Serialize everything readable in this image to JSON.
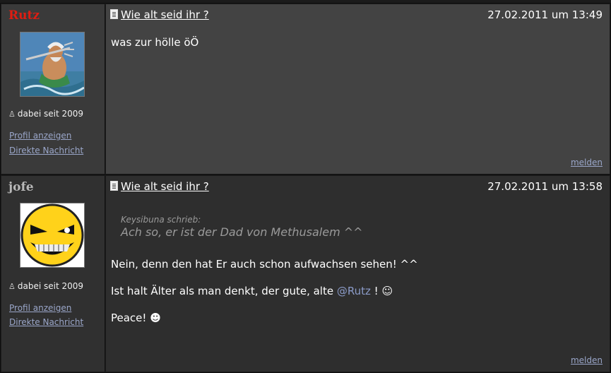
{
  "posts": [
    {
      "username": "Rutz",
      "member_since": "dabei seit 2009",
      "profile_link": "Profil anzeigen",
      "message_link": "Direkte Nachricht",
      "title": "Wie alt seid ihr ?",
      "date": "27.02.2011 um 13:49",
      "body": "was zur hölle öÖ",
      "report": "melden"
    },
    {
      "username": "jofe",
      "member_since": "dabei seit 2009",
      "profile_link": "Profil anzeigen",
      "message_link": "Direkte Nachricht",
      "title": "Wie alt seid ihr ?",
      "date": "27.02.2011 um 13:58",
      "quote_author": "Keysibuna schrieb:",
      "quote_text": "Ach so, er ist der Dad von Methusalem ^^",
      "line1": "Nein, denn den hat Er auch schon aufwachsen sehen! ^^",
      "line2_pre": "Ist halt Älter als man denkt, der gute, alte",
      "line2_mention": "@Rutz",
      "line2_post": "! ☺",
      "line3": "Peace! ☻",
      "report": "melden"
    }
  ],
  "colors": {
    "username_rutz": "#dd1d12",
    "username_jofe": "#b8b8b8",
    "link": "#9aa6c9"
  }
}
